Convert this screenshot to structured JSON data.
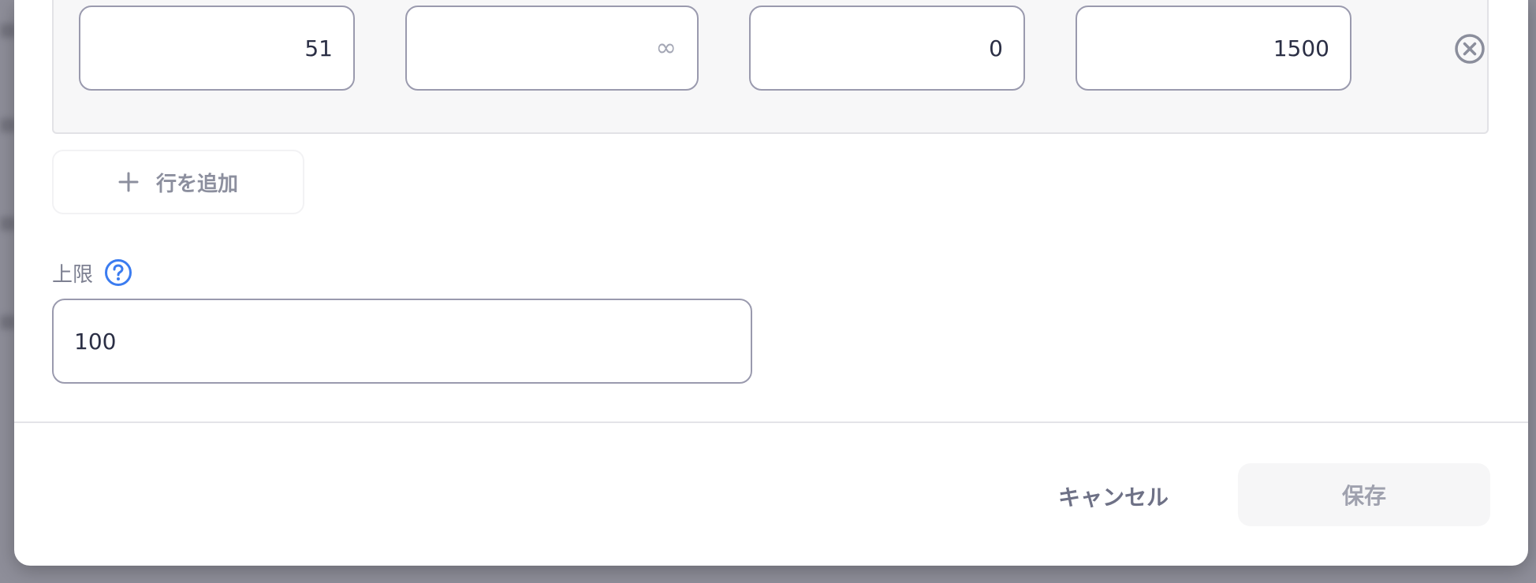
{
  "table": {
    "row": {
      "from_value": "51",
      "to_placeholder": "∞",
      "to_value": "",
      "fixed_value": "0",
      "unit_value": "1500"
    },
    "add_row_label": "行を追加"
  },
  "limit": {
    "label": "上限",
    "value": "100"
  },
  "footer": {
    "cancel_label": "キャンセル",
    "save_label": "保存"
  },
  "colors": {
    "help_icon": "#3b7cf0",
    "remove_icon": "#8b8e9c",
    "input_border": "#9a9aae"
  },
  "icons": {
    "remove": "close-circle-icon",
    "add": "plus-icon",
    "help": "question-circle-icon"
  }
}
